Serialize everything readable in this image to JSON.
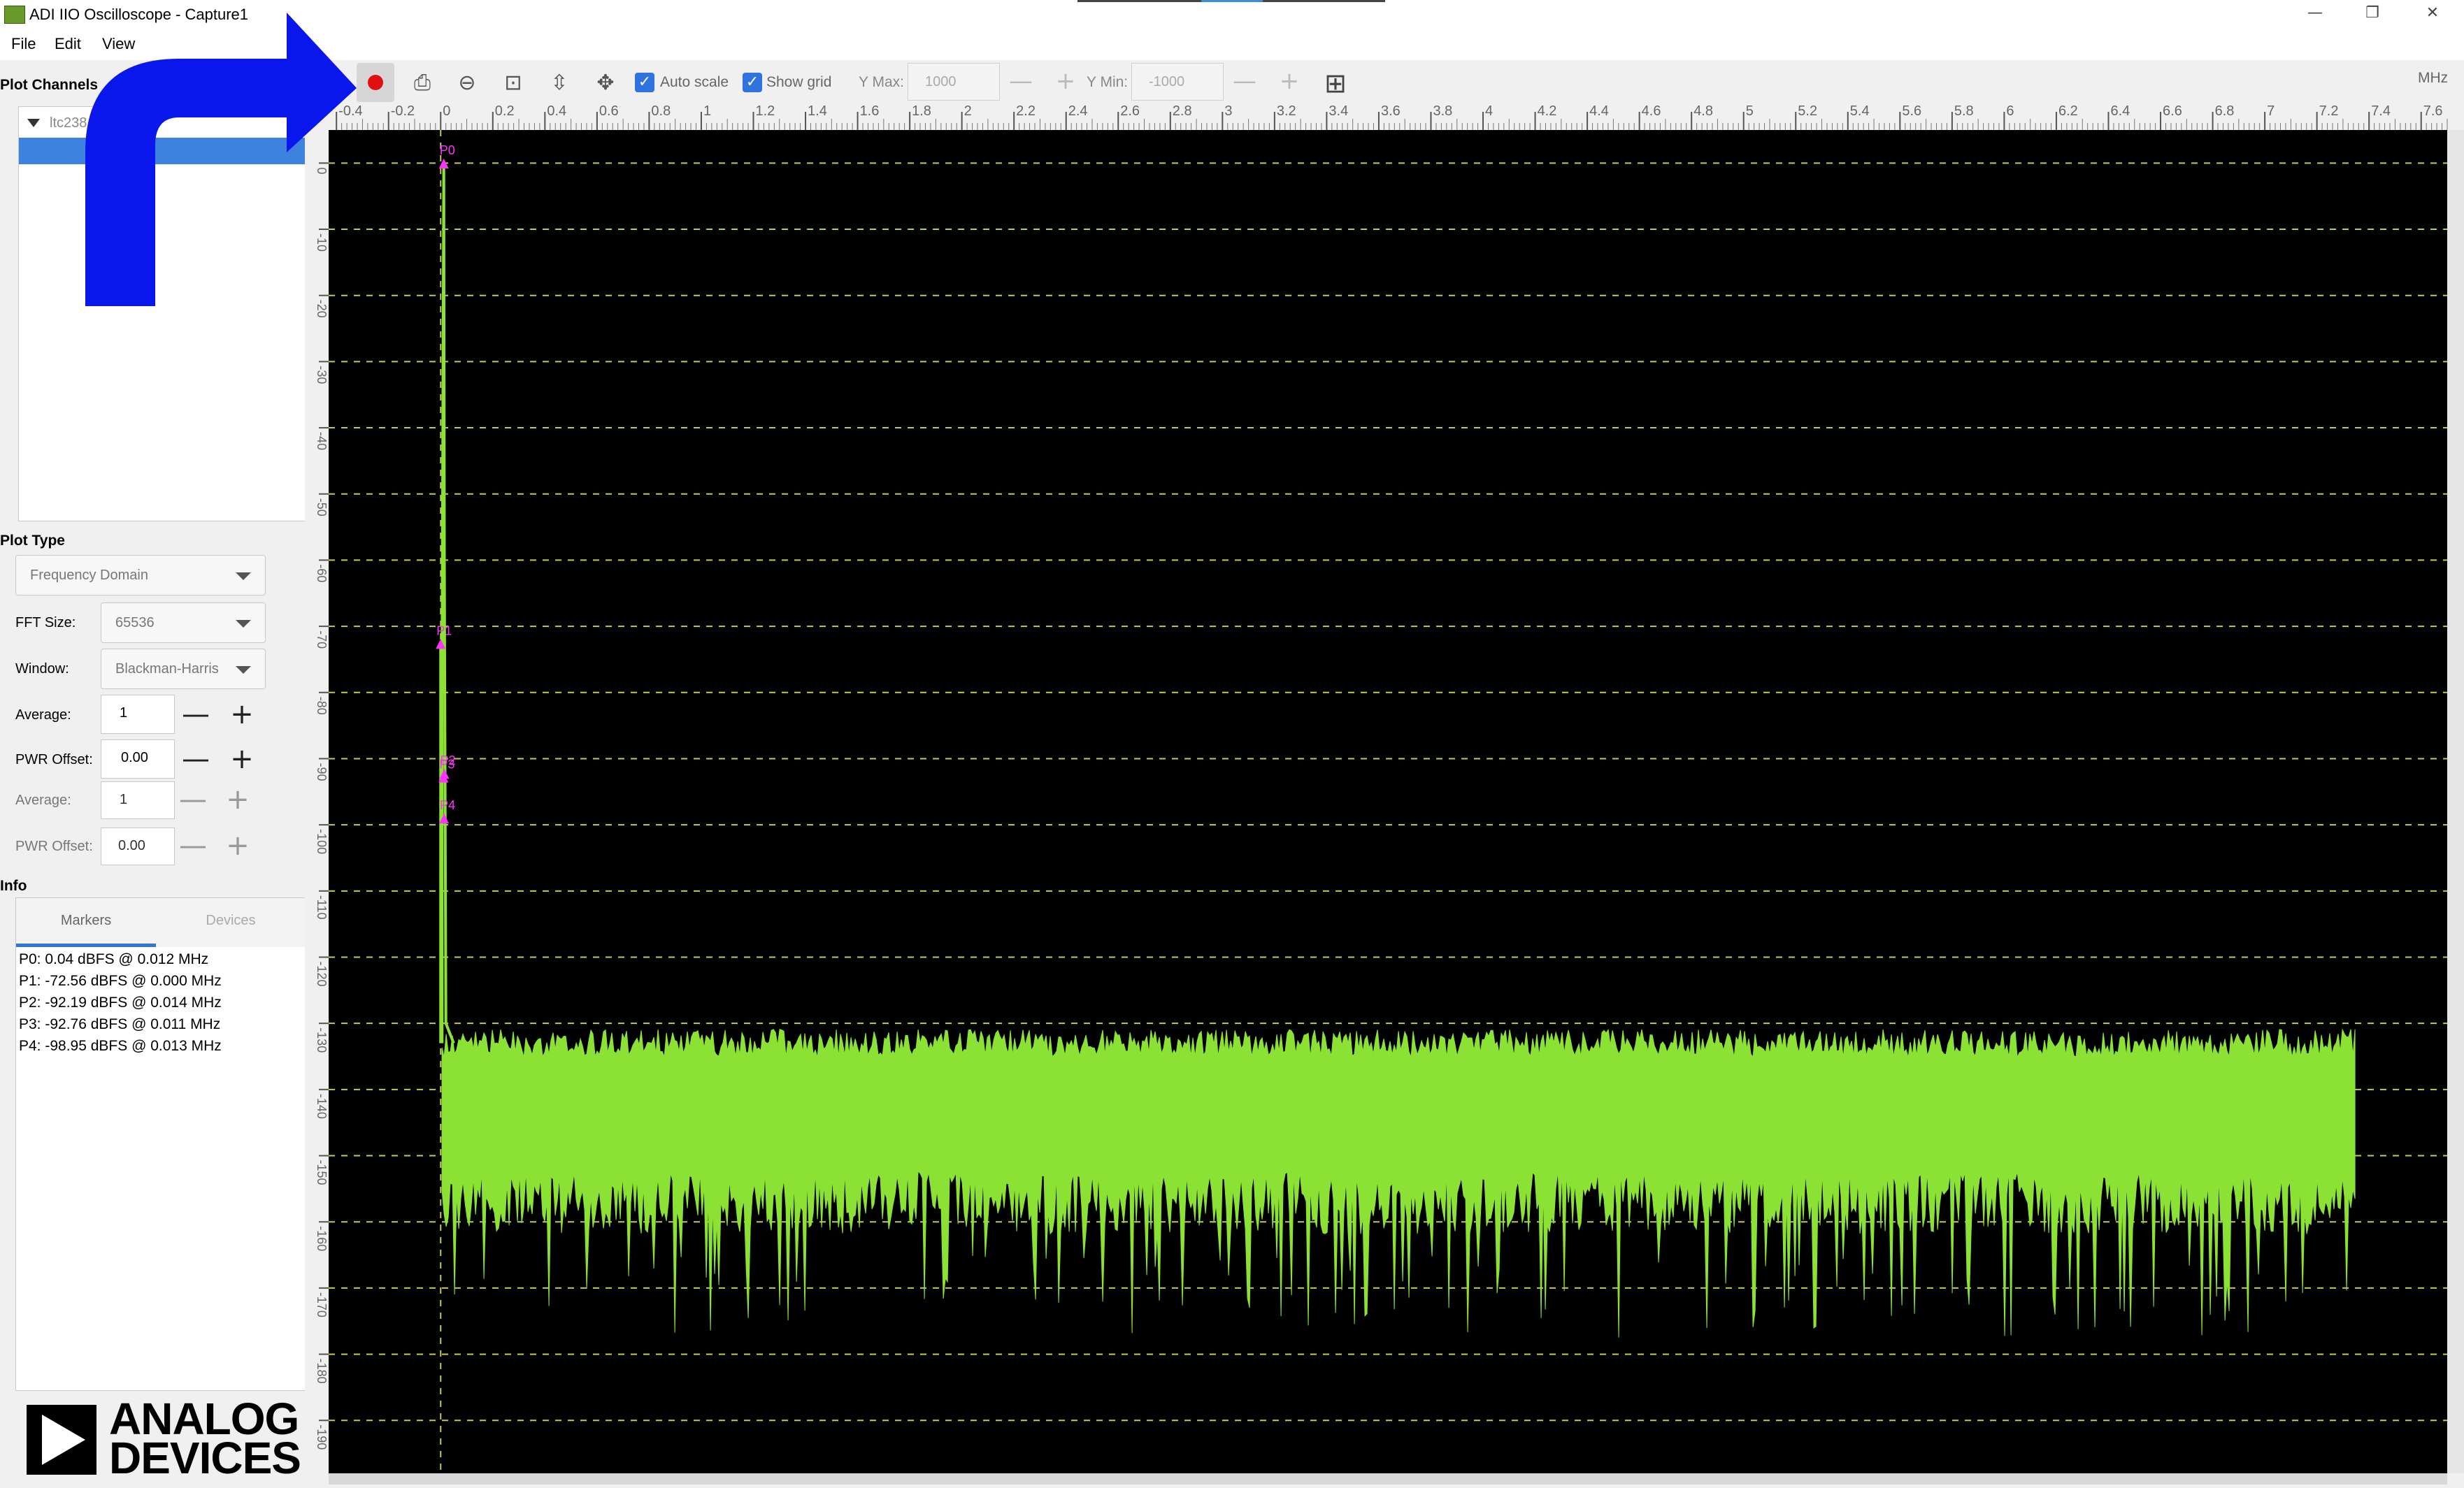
{
  "window": {
    "title": "ADI IIO Oscilloscope - Capture1",
    "controls": [
      "—",
      "❐",
      "✕"
    ]
  },
  "menu": {
    "items": [
      "File",
      "Edit",
      "View"
    ]
  },
  "left_panel": {
    "plot_channels_label": "Plot Channels",
    "device_name": "ltc238",
    "plot_type_label": "Plot Type",
    "plot_type_value": "Frequency Domain",
    "fft_size_label": "FFT Size:",
    "fft_size_value": "65536",
    "window_label": "Window:",
    "window_value": "Blackman-Harris",
    "average_label": "Average:",
    "average_value": "1",
    "pwr_offset_label": "PWR Offset:",
    "pwr_offset_value": "0.00",
    "average2_label": "Average:",
    "average2_value": "1",
    "pwr_offset2_label": "PWR Offset:",
    "pwr_offset2_value": "0.00",
    "minus": "—",
    "plus": "+",
    "info_label": "Info",
    "tabs": [
      "Markers",
      "Devices"
    ],
    "markers": [
      "P0: 0.04 dBFS @ 0.012 MHz",
      "P1: -72.56 dBFS @ 0.000 MHz",
      "P2: -92.19 dBFS @ 0.014 MHz",
      "P3: -92.76 dBFS @ 0.011 MHz",
      "P4: -98.95 dBFS @ 0.013 MHz"
    ],
    "logo": {
      "line1": "ANALOG",
      "line2": "DEVICES"
    }
  },
  "toolbar": {
    "auto_scale_label": "Auto scale",
    "show_grid_label": "Show grid",
    "y_max_label": "Y Max:",
    "y_max_value": "1000",
    "y_min_label": "Y Min:",
    "y_min_value": "-1000",
    "minus": "—",
    "plus": "+",
    "unit": "MHz",
    "icons": {
      "save": "⎙",
      "zoom_out": "⊖",
      "zoom": "⊡",
      "fit": "⇳",
      "pan": "✥",
      "add_plot": "⊞"
    }
  },
  "chart_data": {
    "type": "line",
    "title": "",
    "xlabel": "",
    "ylabel": "",
    "x_ticks": [
      "-0.4",
      "-0.2",
      "0",
      "0.2",
      "0.4",
      "0.6",
      "0.8",
      "1",
      "1.2",
      "1.4",
      "1.6",
      "1.8",
      "2",
      "2.2",
      "2.4",
      "2.6",
      "2.8",
      "3",
      "3.2",
      "3.4",
      "3.6",
      "3.8",
      "4",
      "4.2",
      "4.4",
      "4.6",
      "4.8",
      "5",
      "5.2",
      "5.4",
      "5.6",
      "5.8",
      "6",
      "6.2",
      "6.4",
      "6.6",
      "6.8",
      "7",
      "7.2",
      "7.4",
      "7.6"
    ],
    "y_ticks": [
      "0",
      "-10",
      "-20",
      "-30",
      "-40",
      "-50",
      "-60",
      "-70",
      "-80",
      "-90",
      "-100",
      "-110",
      "-120",
      "-130",
      "-140",
      "-150",
      "-160",
      "-170",
      "-180",
      "-190"
    ],
    "xlim": [
      -0.43,
      7.7
    ],
    "ylim": [
      -198,
      5
    ],
    "x_unit": "MHz",
    "grid": true,
    "series": [
      {
        "color": "#8be234",
        "x": [
          0.0,
          0.005,
          0.01,
          0.012,
          0.014,
          0.02,
          0.05,
          1.0,
          2.0,
          3.0,
          4.0,
          5.0,
          6.0,
          7.0,
          7.35
        ],
        "y": [
          -72.56,
          -80,
          -20,
          0.04,
          -60,
          -130,
          -133,
          -133,
          -133,
          -133,
          -133,
          -133,
          -133,
          -133,
          -133
        ],
        "noise_floor_top": -133,
        "noise_floor_bottom": -165,
        "x_end": 7.35
      }
    ],
    "markers": [
      {
        "label": "P0",
        "x": 0.012,
        "y": 0.04
      },
      {
        "label": "P1",
        "x": 0.0,
        "y": -72.56
      },
      {
        "label": "P2",
        "x": 0.014,
        "y": -92.19
      },
      {
        "label": "P3",
        "x": 0.011,
        "y": -92.76
      },
      {
        "label": "P4",
        "x": 0.013,
        "y": -98.95
      }
    ],
    "colors": {
      "background": "#000000",
      "grid": "#c8c84a",
      "trace": "#8be234",
      "marker": "#ff33ff"
    }
  },
  "annotation": {
    "arrow_color": "#0a17ec"
  }
}
